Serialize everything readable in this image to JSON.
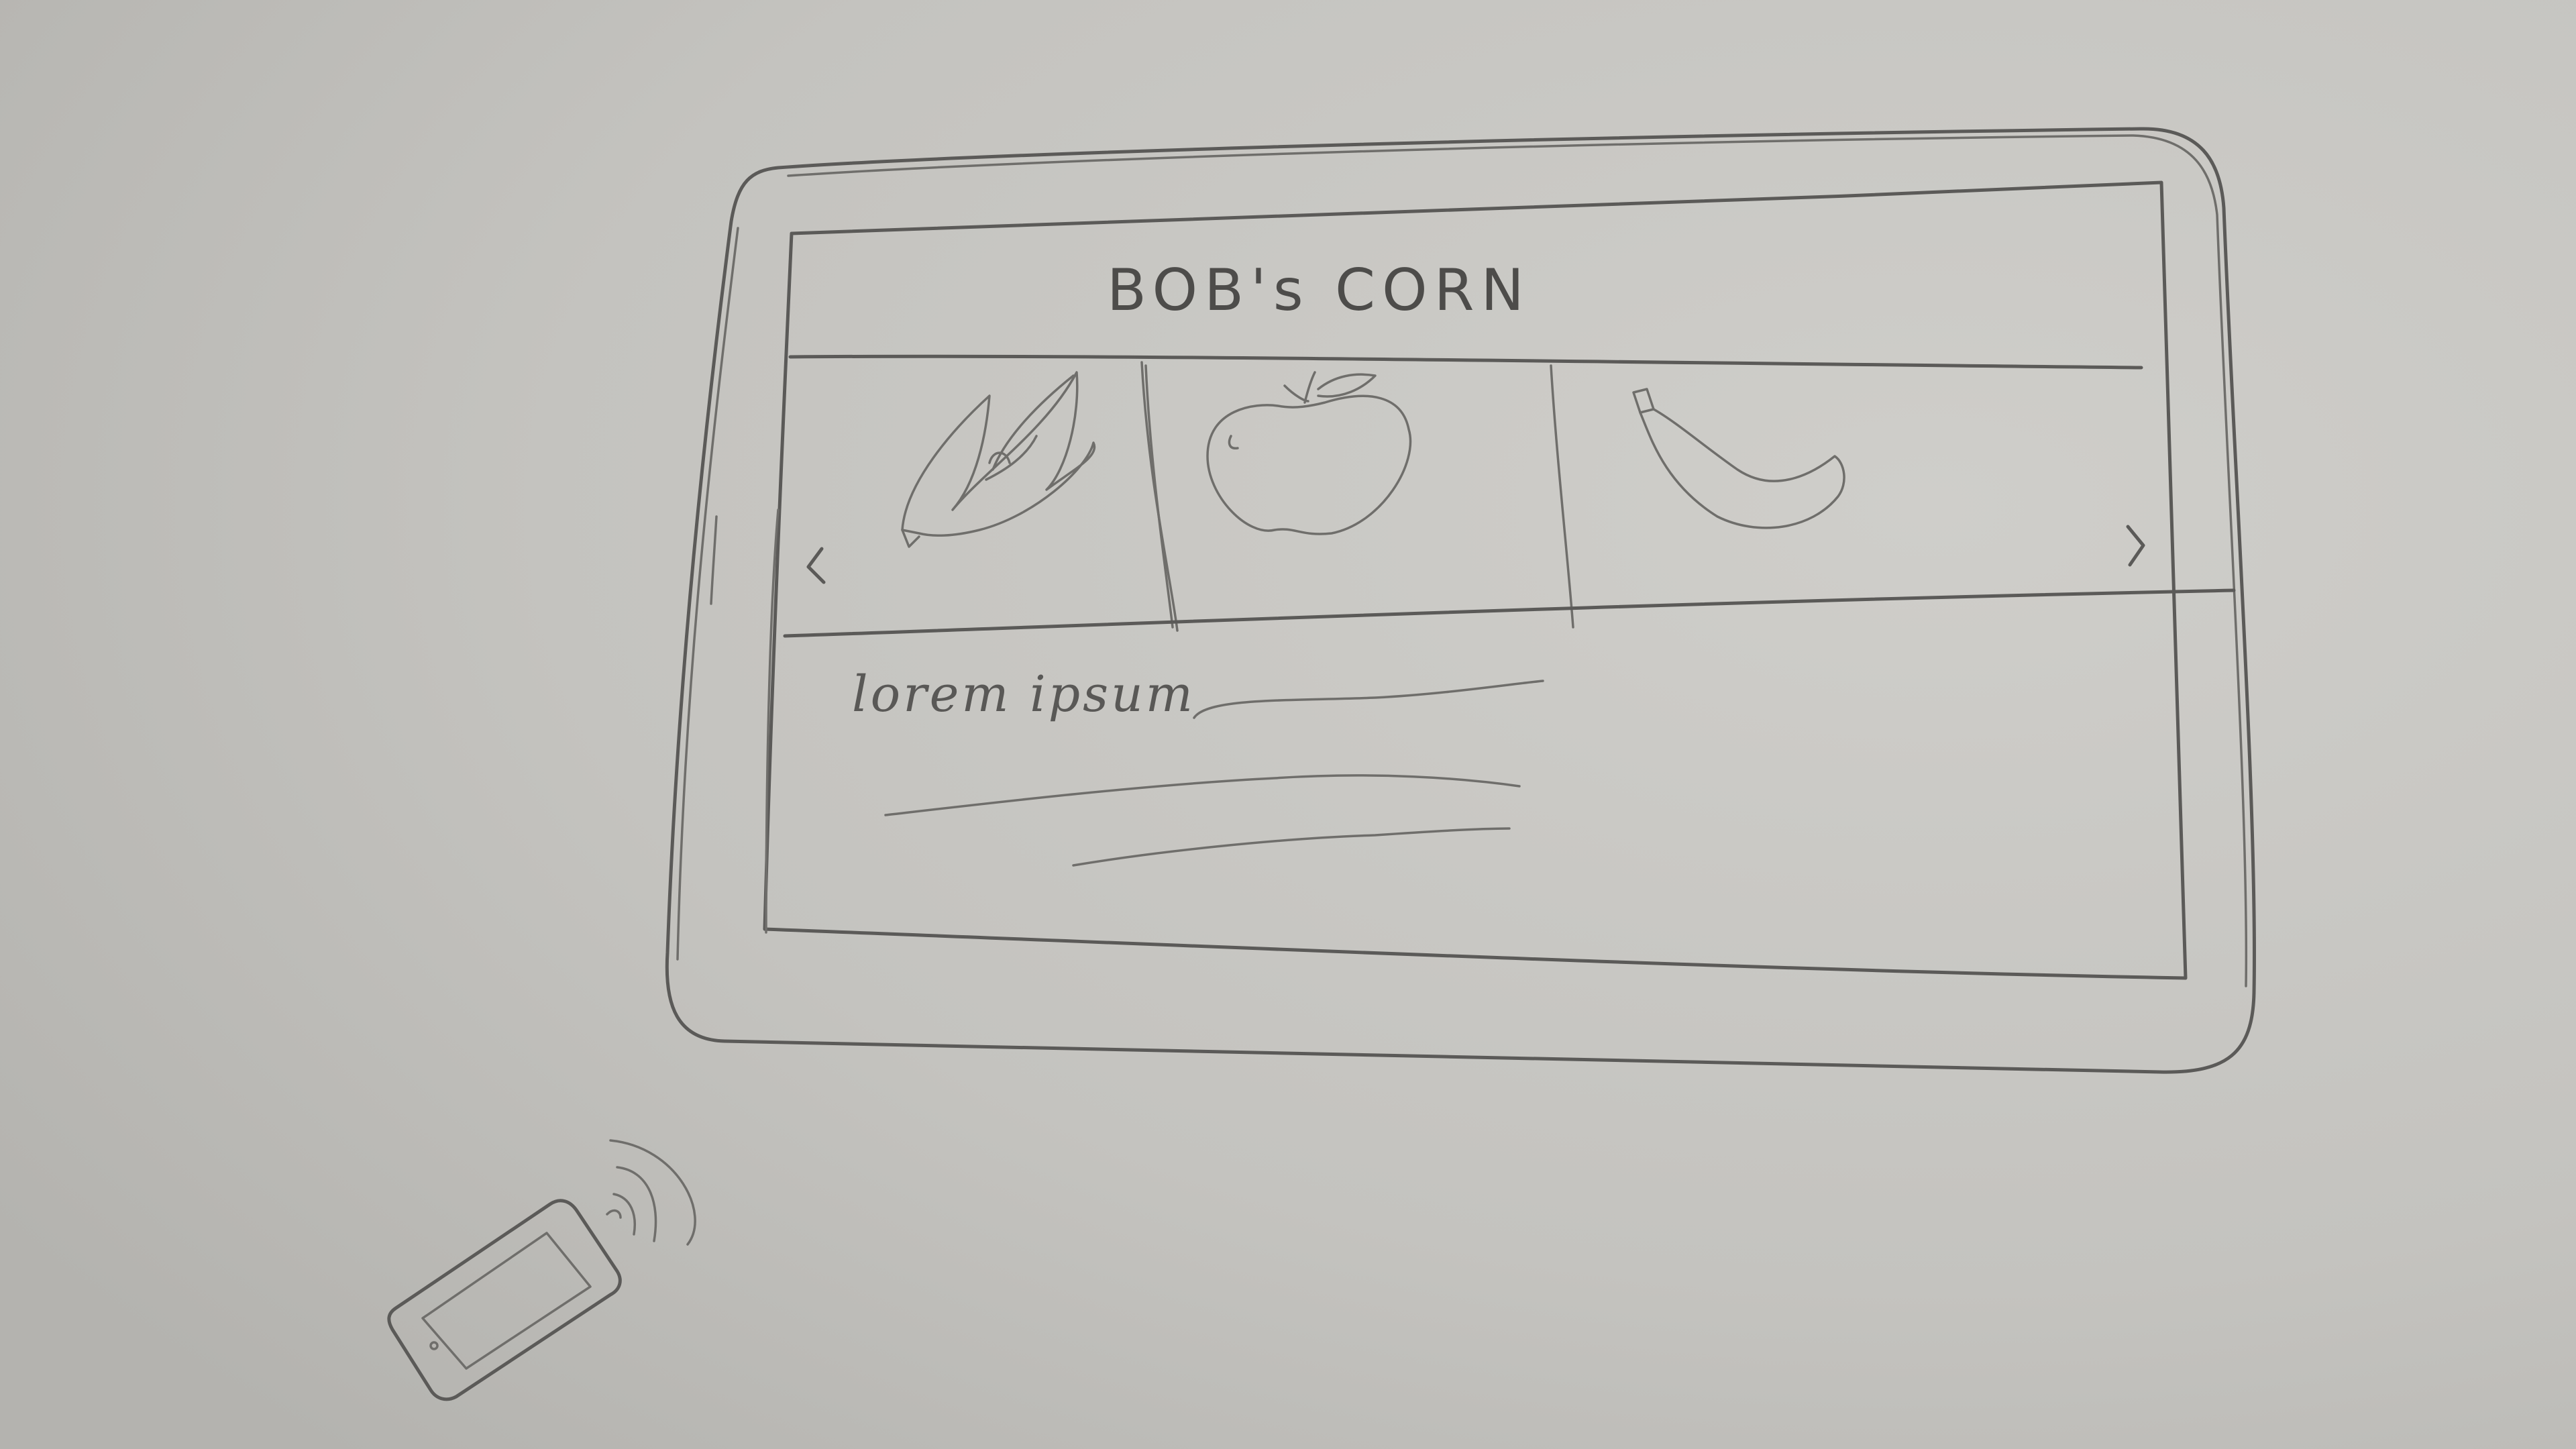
{
  "app": {
    "title": "BOB's CORN"
  },
  "carousel": {
    "items": [
      {
        "name": "corn",
        "icon": "corn-icon"
      },
      {
        "name": "apple",
        "icon": "apple-icon"
      },
      {
        "name": "banana",
        "icon": "banana-icon"
      }
    ],
    "prev_icon": "chevron-left-icon",
    "next_icon": "chevron-right-icon"
  },
  "body": {
    "text": "lorem ipsum"
  },
  "remote": {
    "icon": "phone-remote-icon"
  },
  "colors": {
    "paper": "#c6c5c1",
    "pencil": "#5b5a58"
  }
}
